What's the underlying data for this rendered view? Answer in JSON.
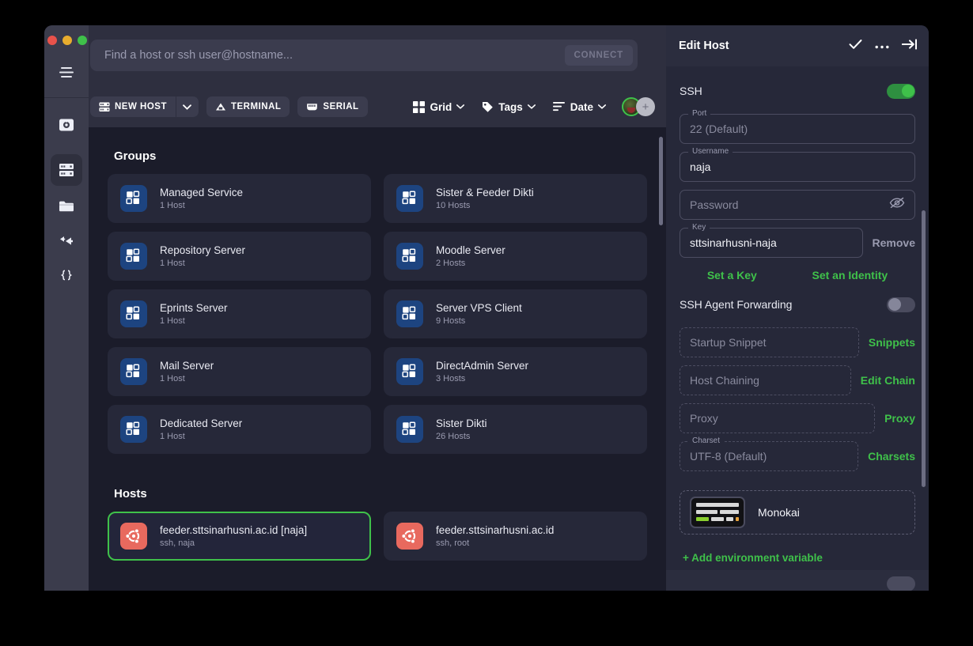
{
  "window": {
    "traffic_lights": [
      "close",
      "minimize",
      "maximize"
    ],
    "hamburger_icon": "hamburger-menu-icon"
  },
  "sidebar": {
    "items": [
      {
        "name": "vault",
        "icon": "vault-icon",
        "active": false
      },
      {
        "name": "servers",
        "icon": "servers-icon",
        "active": true
      },
      {
        "name": "folder",
        "icon": "folder-icon",
        "active": false
      },
      {
        "name": "port-forwarding",
        "icon": "forward-arrow-icon",
        "active": false
      },
      {
        "name": "snippets",
        "icon": "code-braces-icon",
        "active": false
      }
    ]
  },
  "search": {
    "placeholder": "Find a host or ssh user@hostname...",
    "value": "",
    "connect_label": "CONNECT"
  },
  "toolbar": {
    "new_host_label": "NEW HOST",
    "new_host_icon": "server-icon",
    "caret_icon": "chevron-down-icon",
    "terminal_label": "TERMINAL",
    "terminal_icon": "terminal-icon",
    "serial_label": "SERIAL",
    "serial_icon": "serial-icon",
    "view_label": "Grid",
    "view_icon": "grid-icon",
    "tags_label": "Tags",
    "tags_icon": "tag-icon",
    "sort_label": "Date",
    "sort_icon": "sort-icon",
    "avatar_add_label": "+"
  },
  "main": {
    "groups_title": "Groups",
    "hosts_title": "Hosts",
    "groups": [
      {
        "title": "Managed Service",
        "subtitle": "1 Host"
      },
      {
        "title": "Sister & Feeder Dikti",
        "subtitle": "10 Hosts"
      },
      {
        "title": "Repository Server",
        "subtitle": "1 Host"
      },
      {
        "title": "Moodle Server",
        "subtitle": "2 Hosts"
      },
      {
        "title": "Eprints Server",
        "subtitle": "1 Host"
      },
      {
        "title": "Server VPS Client",
        "subtitle": "9 Hosts"
      },
      {
        "title": "Mail Server",
        "subtitle": "1 Host"
      },
      {
        "title": "DirectAdmin Server",
        "subtitle": "3 Hosts"
      },
      {
        "title": "Dedicated Server",
        "subtitle": "1 Host"
      },
      {
        "title": "Sister Dikti",
        "subtitle": "26 Hosts"
      }
    ],
    "hosts": [
      {
        "title": "feeder.sttsinarhusni.ac.id [naja]",
        "subtitle": "ssh, naja",
        "selected": true
      },
      {
        "title": "feeder.sttsinarhusni.ac.id",
        "subtitle": "ssh, root",
        "selected": false
      }
    ]
  },
  "panel": {
    "title": "Edit Host",
    "actions": [
      {
        "name": "confirm",
        "icon": "check-icon"
      },
      {
        "name": "more",
        "icon": "more-dots-icon"
      },
      {
        "name": "collapse",
        "icon": "collapse-panel-icon"
      }
    ],
    "ssh_label": "SSH",
    "ssh_enabled": true,
    "port": {
      "legend": "Port",
      "value": "22 (Default)",
      "is_placeholder": true
    },
    "username": {
      "legend": "Username",
      "value": "naja",
      "is_placeholder": false
    },
    "password": {
      "placeholder": "Password",
      "value": "",
      "reveal_icon": "eye-off-icon"
    },
    "key": {
      "legend": "Key",
      "value": "sttsinarhusni-naja",
      "action": "Remove"
    },
    "set_key_label": "Set a Key",
    "set_identity_label": "Set an Identity",
    "agent_forwarding_label": "SSH Agent Forwarding",
    "agent_forwarding_enabled": false,
    "startup_snippet": {
      "placeholder": "Startup Snippet",
      "action": "Snippets"
    },
    "host_chaining": {
      "placeholder": "Host Chaining",
      "action": "Edit Chain"
    },
    "proxy": {
      "placeholder": "Proxy",
      "action": "Proxy"
    },
    "charset": {
      "legend": "Charset",
      "value": "UTF-8 (Default)",
      "action": "Charsets"
    },
    "theme_name": "Monokai",
    "add_env_label": "+ Add environment variable"
  },
  "colors": {
    "accent_green": "#3fc14a",
    "group_icon_blue": "#1d4480",
    "ubuntu_coral": "#e8695e",
    "panel_bg": "#262839",
    "page_bg": "#1b1c2a",
    "rail_bg": "#3b3c4c"
  }
}
